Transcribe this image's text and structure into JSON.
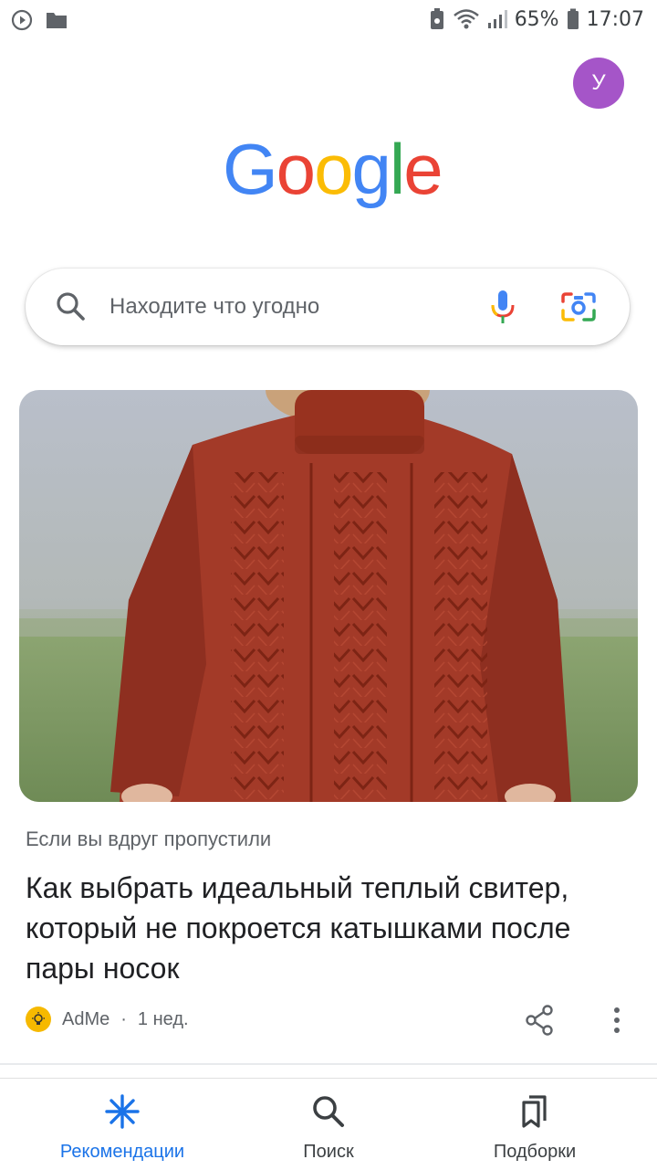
{
  "status_bar": {
    "battery_percent": "65%",
    "time": "17:07"
  },
  "account": {
    "avatar_letter": "У"
  },
  "logo": {
    "letters": [
      "G",
      "o",
      "o",
      "g",
      "l",
      "e"
    ],
    "colors": [
      "#4285f4",
      "#ea4335",
      "#fbbc05",
      "#4285f4",
      "#34a853",
      "#ea4335"
    ]
  },
  "search": {
    "placeholder": "Находите что угодно"
  },
  "card": {
    "kicker": "Если вы вдруг пропустили",
    "title": "Как выбрать идеальный теплый свитер, который не покроется катышками после пары носок",
    "source": "AdMe",
    "age": "1 нед.",
    "image_subject": "sweater-photo"
  },
  "bottom_nav": {
    "items": [
      {
        "label": "Рекомендации",
        "icon": "asterisk-icon",
        "active": true
      },
      {
        "label": "Поиск",
        "icon": "search-icon",
        "active": false
      },
      {
        "label": "Подборки",
        "icon": "bookmarks-icon",
        "active": false
      }
    ]
  },
  "colors": {
    "accent": "#1a73e8",
    "avatar": "#a555c8",
    "sweater": "#a33a28"
  }
}
